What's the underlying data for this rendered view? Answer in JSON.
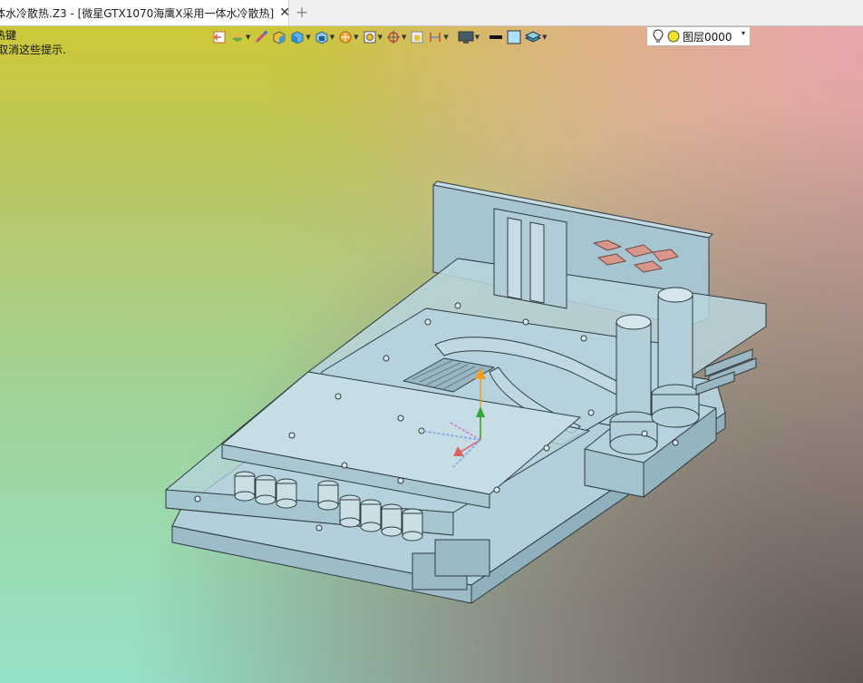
{
  "window": {
    "tab_title": "体水冷散热.Z3 - [微星GTX1070海鹰X采用一体水冷散热]",
    "close_glyph": "✕",
    "new_tab_glyph": "+"
  },
  "hint": {
    "line1": "热键",
    "line2": "取消这些提示."
  },
  "toolbar": {
    "layer_label": "图层0000",
    "layer_dropdown_glyph": "▾"
  },
  "colors": {
    "accent_part": "#a9cbd6",
    "edge": "#2e3a40",
    "axis_x": "#e06060",
    "axis_y": "#2faa3a",
    "axis_z": "#f0a020"
  }
}
